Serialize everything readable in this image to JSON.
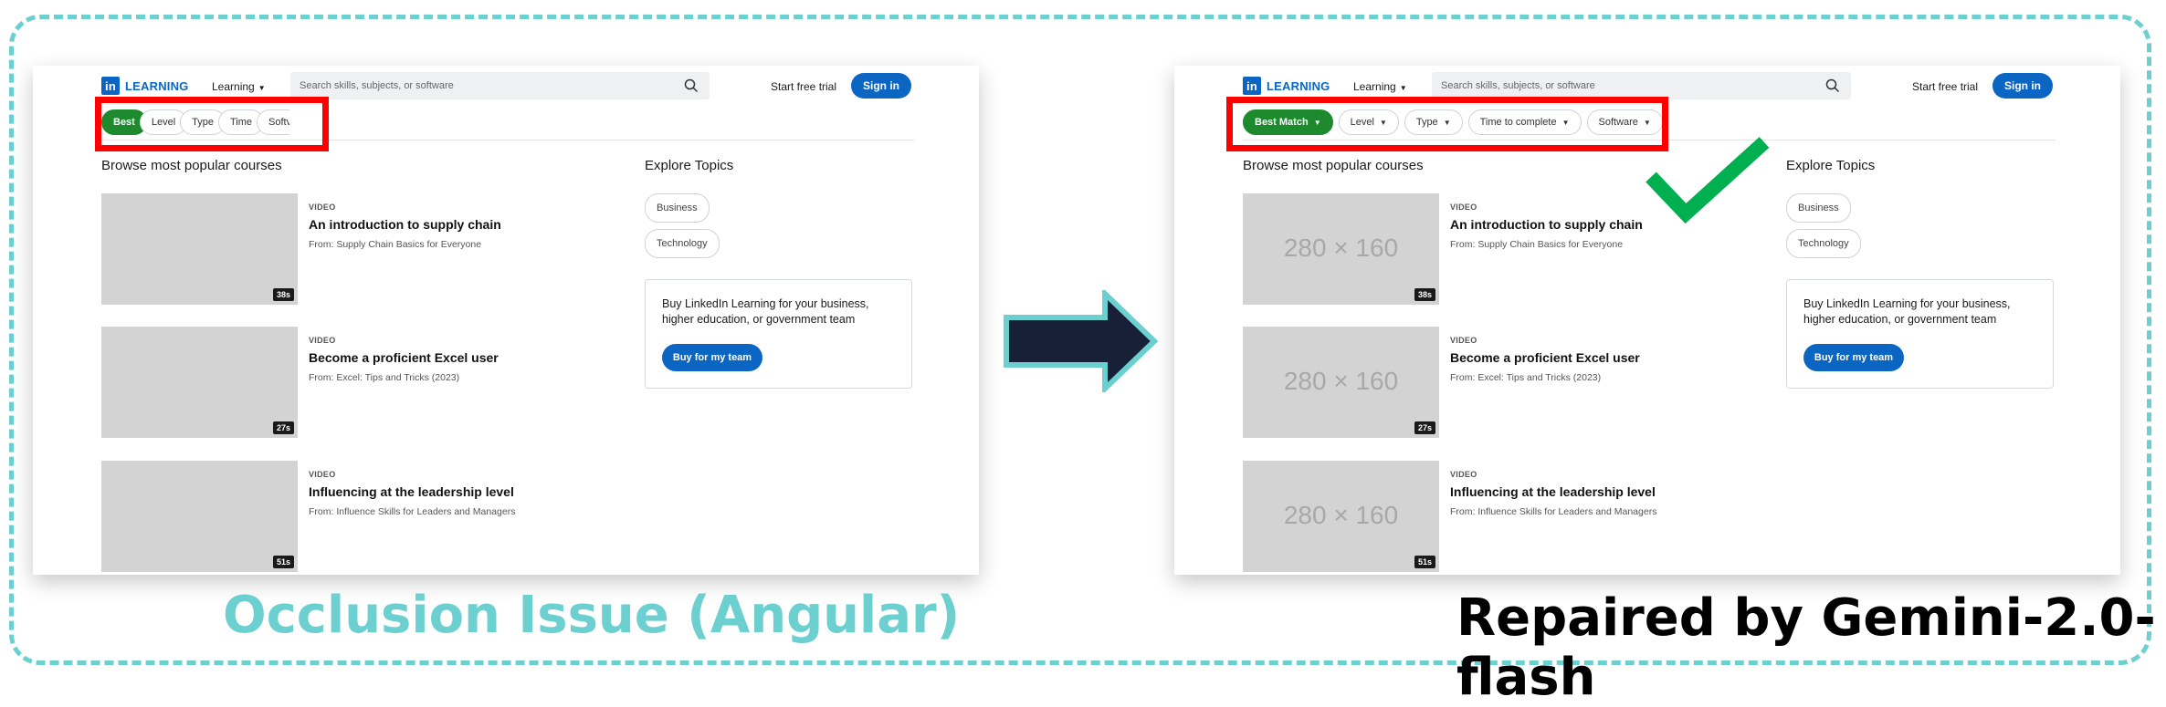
{
  "captions": {
    "left": "Occlusion Issue (Angular)",
    "right": "Repaired by Gemini-2.0-flash"
  },
  "colors": {
    "brand_blue": "#0a66c2",
    "active_chip_green": "#1d8a2e",
    "highlight_red": "#ff0000",
    "frame_teal": "#6ccfd0",
    "arrow_fill": "#172036",
    "check_green": "#00b050"
  },
  "icons": {
    "logo": "linkedin-in-logo",
    "search": "search-icon",
    "caret": "chevron-down-icon",
    "arrow": "right-arrow-icon",
    "check": "checkmark-icon"
  },
  "screens": {
    "left": {
      "brand": {
        "logo": "in",
        "name": "LEARNING"
      },
      "learning_menu": "Learning",
      "search_placeholder": "Search skills, subjects, or software",
      "start_trial": "Start free trial",
      "sign_in": "Sign in",
      "filters": [
        "Best",
        "Level",
        "Type",
        "Time",
        "Softv"
      ],
      "section_title": "Browse most popular courses",
      "courses": [
        {
          "kind": "VIDEO",
          "title": "An introduction to supply chain",
          "from": "From: Supply Chain Basics for Everyone",
          "duration": "38s"
        },
        {
          "kind": "VIDEO",
          "title": "Become a proficient Excel user",
          "from": "From: Excel: Tips and Tricks (2023)",
          "duration": "27s"
        },
        {
          "kind": "VIDEO",
          "title": "Influencing at the leadership level",
          "from": "From: Influence Skills for Leaders and Managers",
          "duration": "51s"
        }
      ],
      "explore_title": "Explore Topics",
      "topics": [
        "Business",
        "Technology"
      ],
      "promo_text": "Buy LinkedIn Learning for your business, higher education, or government team",
      "promo_button": "Buy for my team"
    },
    "right": {
      "brand": {
        "logo": "in",
        "name": "LEARNING"
      },
      "learning_menu": "Learning",
      "search_placeholder": "Search skills, subjects, or software",
      "start_trial": "Start free trial",
      "sign_in": "Sign in",
      "filters": [
        "Best Match",
        "Level",
        "Type",
        "Time to complete",
        "Software"
      ],
      "section_title": "Browse most popular courses",
      "thumbnail_placeholder": "280 × 160",
      "courses": [
        {
          "kind": "VIDEO",
          "title": "An introduction to supply chain",
          "from": "From: Supply Chain Basics for Everyone",
          "duration": "38s"
        },
        {
          "kind": "VIDEO",
          "title": "Become a proficient Excel user",
          "from": "From: Excel: Tips and Tricks (2023)",
          "duration": "27s"
        },
        {
          "kind": "VIDEO",
          "title": "Influencing at the leadership level",
          "from": "From: Influence Skills for Leaders and Managers",
          "duration": "51s"
        }
      ],
      "explore_title": "Explore Topics",
      "topics": [
        "Business",
        "Technology"
      ],
      "promo_text": "Buy LinkedIn Learning for your business, higher education, or government team",
      "promo_button": "Buy for my team"
    }
  }
}
